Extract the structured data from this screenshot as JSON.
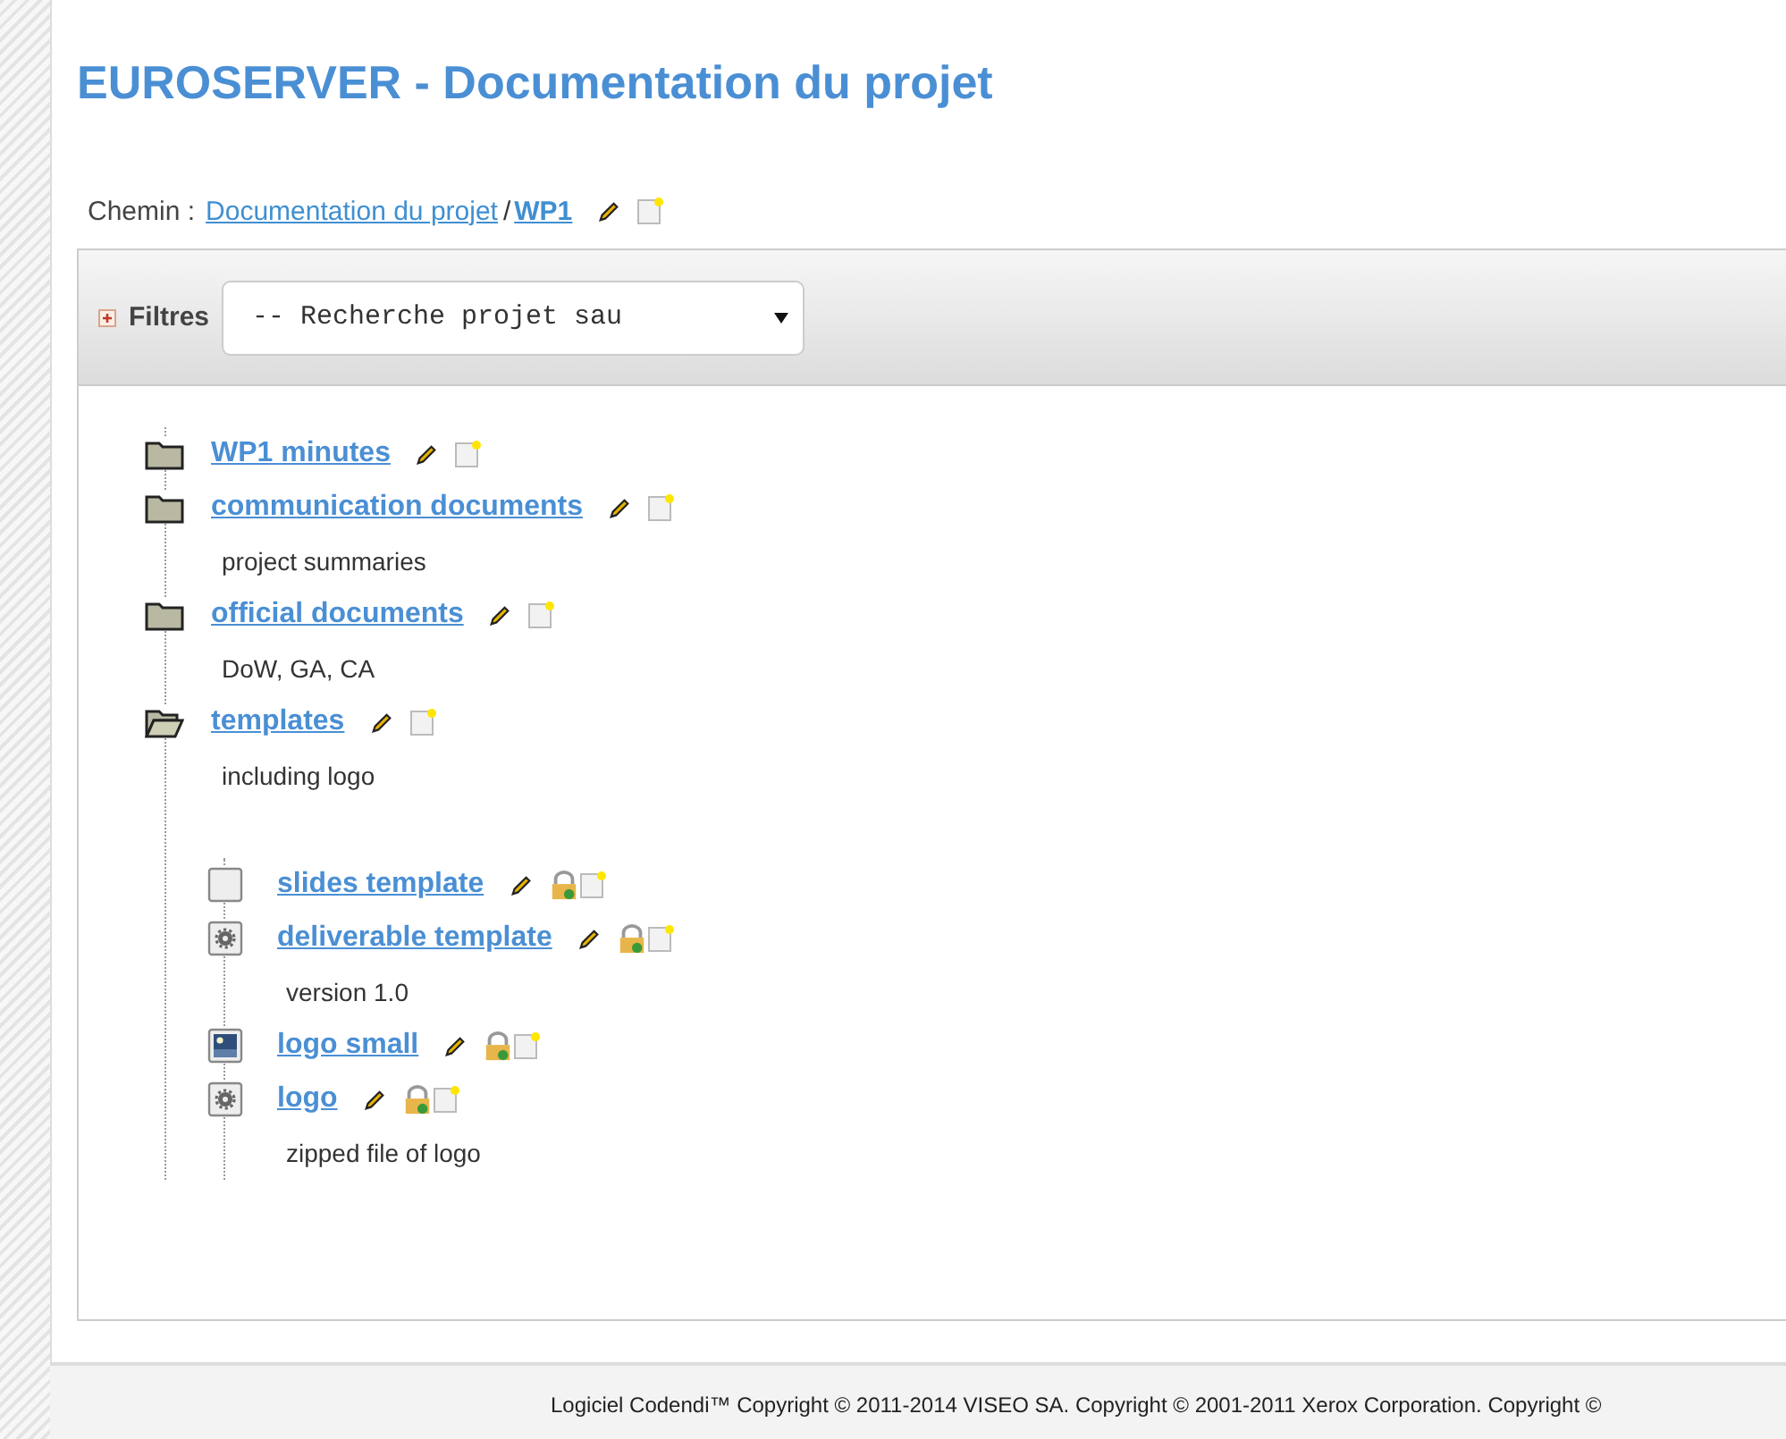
{
  "title": "EUROSERVER - Documentation du projet",
  "breadcrumb": {
    "label": "Chemin :",
    "items": [
      {
        "text": "Documentation du projet",
        "current": false
      },
      {
        "text": "WP1",
        "current": true
      }
    ],
    "separator": "/"
  },
  "filters": {
    "label": "Filtres",
    "expanded": false,
    "select_value": "-- Recherche projet sau"
  },
  "tree": [
    {
      "kind": "folder",
      "name": "WP1 minutes",
      "expanded": false
    },
    {
      "kind": "folder",
      "name": "communication documents",
      "description": "project summaries",
      "expanded": false
    },
    {
      "kind": "folder",
      "name": "official documents",
      "description": "DoW, GA, CA",
      "expanded": false
    },
    {
      "kind": "folder",
      "name": "templates",
      "description": "including logo",
      "expanded": true,
      "children": [
        {
          "kind": "document",
          "name": "slides template"
        },
        {
          "kind": "archive",
          "name": "deliverable template",
          "description": "version 1.0"
        },
        {
          "kind": "image",
          "name": "logo small"
        },
        {
          "kind": "archive",
          "name": "logo",
          "description": "zipped file of logo"
        }
      ]
    }
  ],
  "footer": "Logiciel Codendi™ Copyright © 2011-2014 VISEO SA. Copyright © 2001-2011 Xerox Corporation. Copyright ©"
}
